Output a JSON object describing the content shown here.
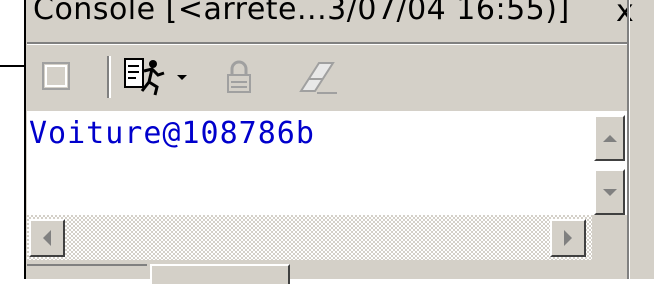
{
  "window": {
    "title": "Console [<arrete...3/07/04 16:55)]",
    "close_glyph": "x"
  },
  "toolbar": {
    "buttons": [
      {
        "name": "terminate",
        "icon": "stop-square-icon",
        "enabled": false
      },
      {
        "name": "run",
        "icon": "running-man-icon",
        "enabled": true
      },
      {
        "name": "run-menu",
        "icon": "dropdown-arrow-icon",
        "enabled": true
      },
      {
        "name": "lock",
        "icon": "lock-icon",
        "enabled": false
      },
      {
        "name": "clear",
        "icon": "eraser-icon",
        "enabled": false
      }
    ]
  },
  "console": {
    "lines": [
      "Voiture@108786b"
    ],
    "text_color": "#0000cc"
  },
  "colors": {
    "panel": "#d4d0c8",
    "shadow": "#808080",
    "highlight": "#ffffff"
  }
}
